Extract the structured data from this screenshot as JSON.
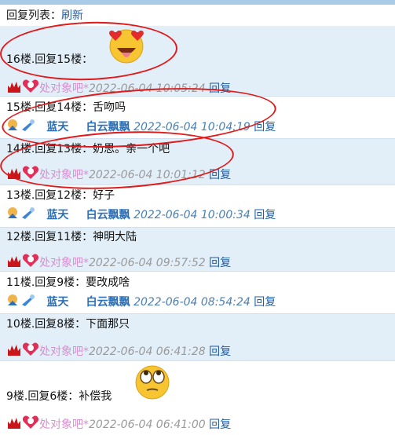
{
  "header": {
    "title": "回复列表：",
    "refresh": "刷新"
  },
  "users": {
    "pink": "处对象吧*",
    "blue1": "蓝天",
    "blue2": "白云飘飘"
  },
  "reply_label": "回复",
  "replies": [
    {
      "text": "16楼.回复15楼：",
      "user": "pink",
      "time": "2022-06-04 10:05:24"
    },
    {
      "text": "15楼.回复14楼：舌吻吗",
      "user": "blue",
      "time": "2022-06-04 10:04:19"
    },
    {
      "text": "14楼.回复13楼：奶思。亲一个吧",
      "user": "pink",
      "time": "2022-06-04 10:01:12"
    },
    {
      "text": "13楼.回复12楼：好子",
      "user": "blue",
      "time": "2022-06-04 10:00:34"
    },
    {
      "text": "12楼.回复11楼：神明大陆",
      "user": "pink",
      "time": "2022-06-04 09:57:52"
    },
    {
      "text": "11楼.回复9楼：要改成啥",
      "user": "blue",
      "time": "2022-06-04 08:54:24"
    },
    {
      "text": "10楼.回复8楼：下面那只",
      "user": "pink",
      "time": "2022-06-04 06:41:28"
    },
    {
      "text": "9楼.回复6楼：补偿我",
      "user": "pink",
      "time": "2022-06-04 06:41:00"
    }
  ],
  "colors": {
    "link": "#1f5fa8",
    "row_alt": "#e2eef8",
    "annotation": "#e01a1a"
  }
}
